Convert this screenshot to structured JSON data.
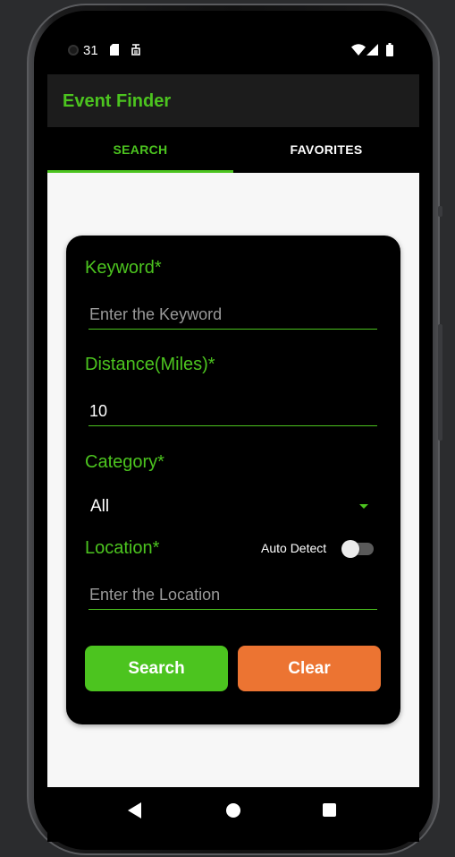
{
  "status_bar": {
    "time": "31",
    "icons": [
      "camera-icon",
      "sd-card-icon",
      "data-saver-icon",
      "wifi-icon",
      "signal-icon",
      "battery-icon"
    ]
  },
  "app_bar": {
    "title": "Event Finder"
  },
  "tabs": [
    {
      "label": "SEARCH",
      "selected": true
    },
    {
      "label": "FAVORITES",
      "selected": false
    }
  ],
  "form": {
    "keyword": {
      "label": "Keyword*",
      "placeholder": "Enter the Keyword",
      "value": ""
    },
    "distance": {
      "label": "Distance(Miles)*",
      "value": "10"
    },
    "category": {
      "label": "Category*",
      "selected": "All"
    },
    "location": {
      "label": "Location*",
      "placeholder": "Enter the Location",
      "value": ""
    },
    "auto_detect": {
      "label": "Auto Detect",
      "enabled": false
    }
  },
  "buttons": {
    "search": "Search",
    "clear": "Clear"
  },
  "colors": {
    "accent": "#4cc41f",
    "clear_button": "#ec7432",
    "card": "#000000",
    "background": "#f7f7f7"
  },
  "nav_bar": {
    "icons": [
      "back-icon",
      "home-icon",
      "recents-icon"
    ]
  }
}
